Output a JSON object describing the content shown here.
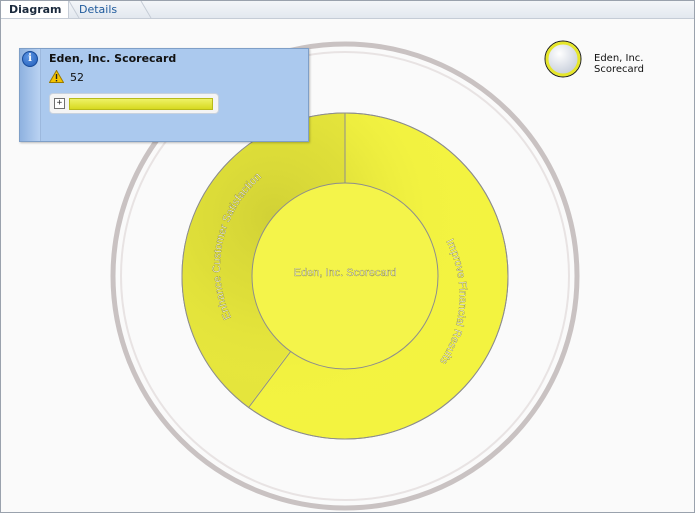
{
  "tabs": [
    {
      "label": "Diagram",
      "selected": true
    },
    {
      "label": "Details",
      "selected": false
    }
  ],
  "info_panel": {
    "title": "Eden, Inc. Scorecard",
    "warning_count": "52",
    "bar_color": "#e3e631"
  },
  "legend": {
    "label": "Eden, Inc. Scorecard"
  },
  "diagram": {
    "center_label": "Eden, Inc. Scorecard",
    "segments": [
      {
        "label": "Enhance Customer Satisfaction",
        "color": "#dcdc3a"
      },
      {
        "label": "Improve Financial Results",
        "color": "#f2f23f"
      }
    ]
  },
  "colors": {
    "accent_blue": "#abc9ee",
    "status_yellow": "#f2f23f"
  }
}
